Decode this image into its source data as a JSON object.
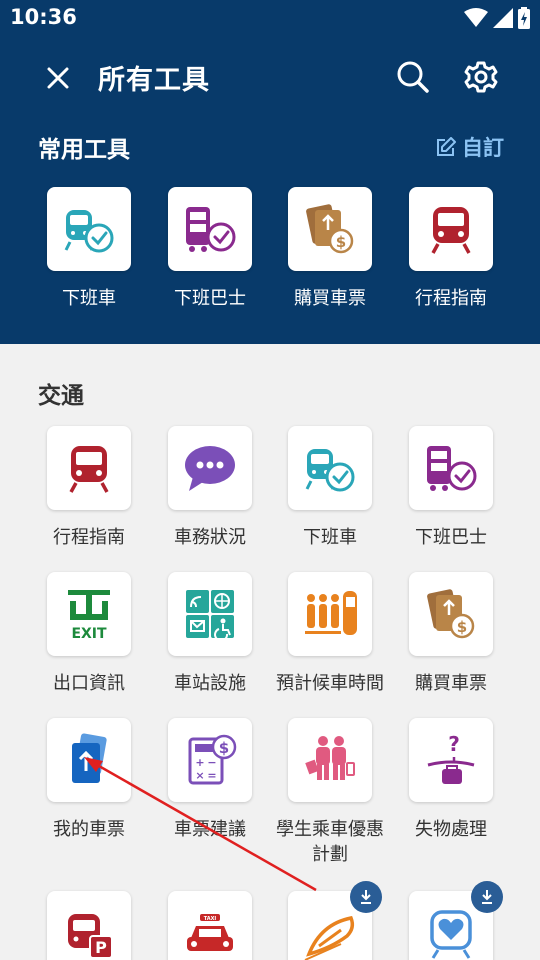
{
  "status_bar": {
    "time": "10:36"
  },
  "header": {
    "title": "所有工具"
  },
  "favorites": {
    "title": "常用工具",
    "customize_label": "自訂",
    "items": [
      {
        "label": "下班車",
        "icon": "train-clock-icon"
      },
      {
        "label": "下班巴士",
        "icon": "bus-clock-icon"
      },
      {
        "label": "購買車票",
        "icon": "ticket-purchase-icon"
      },
      {
        "label": "行程指南",
        "icon": "train-front-icon"
      }
    ]
  },
  "transport": {
    "title": "交通",
    "items": [
      {
        "label": "行程指南",
        "icon": "train-front-icon"
      },
      {
        "label": "車務狀況",
        "icon": "speech-bubble-icon"
      },
      {
        "label": "下班車",
        "icon": "train-clock-icon"
      },
      {
        "label": "下班巴士",
        "icon": "bus-clock-icon"
      },
      {
        "label": "出口資訊",
        "icon": "exit-sign-icon"
      },
      {
        "label": "車站設施",
        "icon": "facilities-icon"
      },
      {
        "label": "預計候車時間",
        "icon": "waiting-people-icon"
      },
      {
        "label": "購買車票",
        "icon": "ticket-purchase-icon"
      },
      {
        "label": "我的車票",
        "icon": "my-ticket-icon"
      },
      {
        "label": "車票建議",
        "icon": "fare-calculator-icon"
      },
      {
        "label": "學生乘車優惠計劃",
        "icon": "student-concession-icon"
      },
      {
        "label": "失物處理",
        "icon": "lost-property-icon"
      },
      {
        "label": "",
        "icon": "park-and-ride-icon"
      },
      {
        "label": "",
        "icon": "taxi-icon"
      },
      {
        "label": "",
        "icon": "high-speed-rail-icon",
        "download": true
      },
      {
        "label": "",
        "icon": "heart-train-icon",
        "download": true
      }
    ]
  },
  "colors": {
    "header_bg": "#083a6a",
    "accent_link": "#8cc3f3",
    "page_bg": "#f1f1f1",
    "annotation_arrow": "#e02020"
  }
}
